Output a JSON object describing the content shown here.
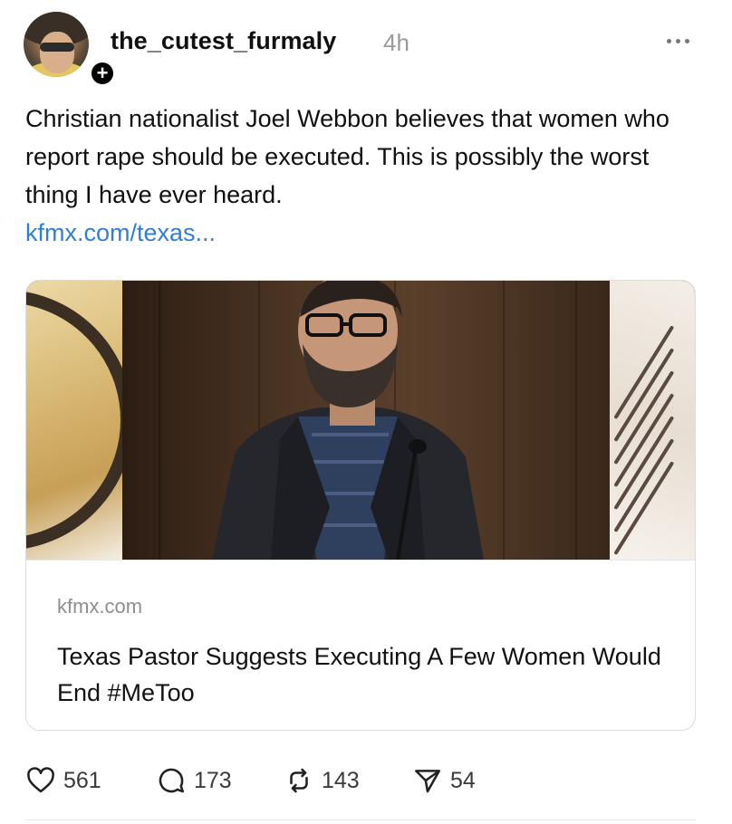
{
  "post": {
    "username": "the_cutest_furmaly",
    "timestamp": "4h",
    "follow_badge": "+",
    "text": "Christian nationalist Joel Webbon believes that women who report rape should be executed. This is possibly the worst thing I have ever heard.",
    "link_text": "kfmx.com/texas..."
  },
  "card": {
    "domain": "kfmx.com",
    "title": "Texas Pastor Suggests Executing A Few Women Would End #MeToo"
  },
  "actions": {
    "likes": "561",
    "replies": "173",
    "reposts": "143",
    "shares": "54"
  },
  "icons": {
    "more": "more-horizontal-icon",
    "like": "heart-icon",
    "reply": "comment-bubble-icon",
    "repost": "repost-arrows-icon",
    "share": "send-icon"
  },
  "colors": {
    "link": "#2f7fd6",
    "muted": "#9a9a9a"
  }
}
